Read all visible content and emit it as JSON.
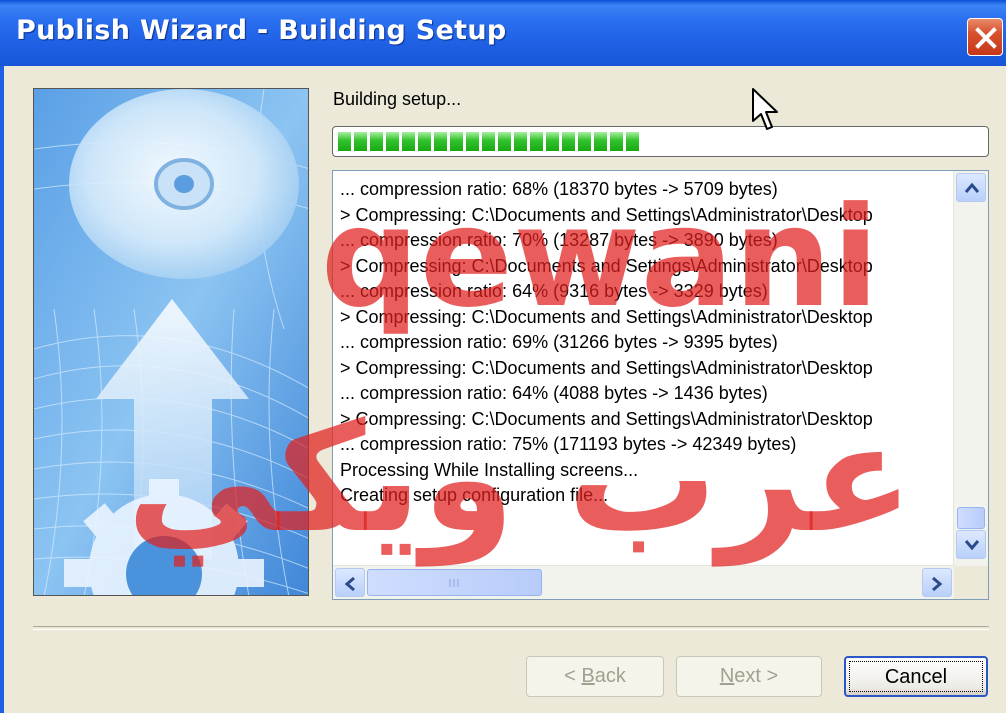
{
  "window": {
    "title": "Publish Wizard - Building Setup",
    "close_icon": "close-icon"
  },
  "status": {
    "text": "Building setup...",
    "progress_percent": 48
  },
  "log": {
    "lines": [
      "... compression ratio: 68% (18370 bytes -> 5709 bytes)",
      "> Compressing: C:\\Documents and Settings\\Administrator\\Desktop",
      "... compression ratio: 70% (13287 bytes -> 3890 bytes)",
      "> Compressing: C:\\Documents and Settings\\Administrator\\Desktop",
      "... compression ratio: 64% (9316 bytes -> 3329 bytes)",
      "> Compressing: C:\\Documents and Settings\\Administrator\\Desktop",
      "... compression ratio: 69% (31266 bytes -> 9395 bytes)",
      "> Compressing: C:\\Documents and Settings\\Administrator\\Desktop",
      "... compression ratio: 64% (4088 bytes -> 1436 bytes)",
      "> Compressing: C:\\Documents and Settings\\Administrator\\Desktop",
      "... compression ratio: 75% (171193 bytes -> 42349 bytes)",
      "Processing While Installing screens...",
      "Creating setup configuration file..."
    ]
  },
  "buttons": {
    "back": {
      "pre": "< ",
      "key": "B",
      "post": "ack"
    },
    "next": {
      "key": "N",
      "post": "ext >"
    },
    "cancel": "Cancel"
  },
  "watermark": {
    "latin": "qewani",
    "arabic": "عرب ويكي"
  },
  "colors": {
    "titlebar": "#1e5fe3",
    "progress": "#19a914",
    "watermark": "#e0201f"
  }
}
